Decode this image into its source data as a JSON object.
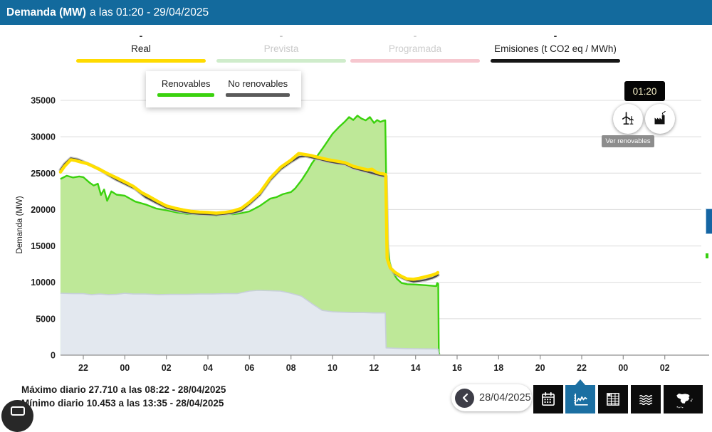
{
  "header": {
    "title_bold": "Demanda (MW)",
    "title_rest": "a las 01:20 - 29/04/2025"
  },
  "legend": {
    "items": [
      {
        "label": "Real",
        "value_dash": "-",
        "bar_color": "#ffdb00",
        "label_color": "#1d1d1d",
        "dash_color": "#2a2a2a",
        "active": true
      },
      {
        "label": "Prevista",
        "value_dash": "-",
        "bar_color": "#cfeccb",
        "label_color": "#c9c9c9",
        "dash_color": "#c4c4c4",
        "active": false
      },
      {
        "label": "Programada",
        "value_dash": "-",
        "bar_color": "#f6c7cf",
        "label_color": "#cdcdcd",
        "dash_color": "#cfcfcf",
        "active": false
      },
      {
        "label": "Emisiones (t CO2 eq / MWh)",
        "value_dash": "-",
        "bar_color": "#161616",
        "label_color": "#1d1d1d",
        "dash_color": "#2a2a2a",
        "active": true
      }
    ]
  },
  "renewables_toggle": {
    "items": [
      {
        "label": "Renovables",
        "bar_color": "#3bd20e"
      },
      {
        "label": "No renovables",
        "bar_color": "#5a5a5a"
      }
    ]
  },
  "time_tooltip": "01:20",
  "ver_renovables_tooltip": "Ver renovables",
  "footer": {
    "max_line": "Máximo diario 27.710 a las 08:22 - 28/04/2025",
    "min_line": "Mínimo diario 10.453 a las 13:35 - 28/04/2025"
  },
  "date_nav": {
    "date": "28/04/2025"
  },
  "chart_data": {
    "type": "line+area",
    "title": "Demanda (MW) a las 01:20 - 29/04/2025",
    "ylabel": "Demanda (MW)",
    "ylim": [
      0,
      35000
    ],
    "grid": "horizontal",
    "y_ticks": [
      0,
      5000,
      10000,
      15000,
      20000,
      25000,
      30000,
      35000
    ],
    "x_ticks": [
      {
        "t": 22,
        "label": "22"
      },
      {
        "t": 24,
        "label": "00"
      },
      {
        "t": 26,
        "label": "02"
      },
      {
        "t": 28,
        "label": "04"
      },
      {
        "t": 30,
        "label": "06"
      },
      {
        "t": 32,
        "label": "08"
      },
      {
        "t": 34,
        "label": "10"
      },
      {
        "t": 36,
        "label": "12"
      },
      {
        "t": 38,
        "label": "14"
      },
      {
        "t": 40,
        "label": "16"
      },
      {
        "t": 42,
        "label": "18"
      },
      {
        "t": 44,
        "label": "20"
      },
      {
        "t": 46,
        "label": "22"
      },
      {
        "t": 48,
        "label": "00"
      },
      {
        "t": 50,
        "label": "02"
      }
    ],
    "x_note": "t = decimal hours from 00:00 of 27/04; 36 = 12:00 on 28/04; blackout drop at 12:33",
    "series": [
      {
        "id": "renovables",
        "name": "Renovables",
        "kind": "area",
        "fill": "#bee898",
        "stroke": "#3bd20e",
        "stroke_width": 2.4,
        "points": [
          [
            20.9,
            24200
          ],
          [
            21.2,
            24650
          ],
          [
            21.5,
            24400
          ],
          [
            21.8,
            24550
          ],
          [
            22.0,
            24450
          ],
          [
            22.3,
            23700
          ],
          [
            22.5,
            23300
          ],
          [
            22.7,
            23550
          ],
          [
            22.85,
            22000
          ],
          [
            23.0,
            22750
          ],
          [
            23.15,
            21200
          ],
          [
            23.35,
            22500
          ],
          [
            23.6,
            22050
          ],
          [
            24.0,
            21900
          ],
          [
            24.5,
            21100
          ],
          [
            25.0,
            20700
          ],
          [
            25.5,
            20150
          ],
          [
            26.0,
            19900
          ],
          [
            26.5,
            19600
          ],
          [
            27.0,
            19400
          ],
          [
            27.5,
            19350
          ],
          [
            28.0,
            19400
          ],
          [
            28.4,
            19150
          ],
          [
            28.8,
            19500
          ],
          [
            29.2,
            19350
          ],
          [
            29.6,
            19500
          ],
          [
            30.0,
            19750
          ],
          [
            30.5,
            20500
          ],
          [
            31.0,
            21500
          ],
          [
            31.3,
            21700
          ],
          [
            31.6,
            22100
          ],
          [
            32.0,
            22400
          ],
          [
            32.2,
            22900
          ],
          [
            32.5,
            24000
          ],
          [
            32.8,
            25300
          ],
          [
            33.0,
            26300
          ],
          [
            33.3,
            27500
          ],
          [
            33.6,
            28700
          ],
          [
            34.0,
            30400
          ],
          [
            34.3,
            31300
          ],
          [
            34.6,
            32100
          ],
          [
            34.8,
            32700
          ],
          [
            35.0,
            32300
          ],
          [
            35.2,
            32900
          ],
          [
            35.4,
            32500
          ],
          [
            35.6,
            32250
          ],
          [
            35.8,
            32700
          ],
          [
            36.0,
            31900
          ],
          [
            36.15,
            32300
          ],
          [
            36.3,
            32050
          ],
          [
            36.45,
            32200
          ],
          [
            36.54,
            32250
          ],
          [
            36.58,
            24800
          ],
          [
            36.65,
            16000
          ],
          [
            36.75,
            12800
          ],
          [
            36.9,
            11400
          ],
          [
            37.1,
            10500
          ],
          [
            37.33,
            9900
          ],
          [
            37.6,
            9750
          ],
          [
            38.0,
            9700
          ],
          [
            38.5,
            9600
          ],
          [
            38.9,
            9500
          ],
          [
            39.0,
            9480
          ],
          [
            39.04,
            9900
          ],
          [
            39.09,
            9800
          ],
          [
            39.12,
            400
          ],
          [
            39.15,
            100
          ]
        ]
      },
      {
        "id": "no-renovables",
        "name": "No renovables",
        "kind": "area",
        "fill": "#e3e8ef",
        "stroke": "#c7cfda",
        "stroke_width": 1.6,
        "points": [
          [
            20.9,
            8500
          ],
          [
            21.5,
            8450
          ],
          [
            22.0,
            8450
          ],
          [
            22.4,
            8300
          ],
          [
            22.8,
            8400
          ],
          [
            23.2,
            8300
          ],
          [
            23.6,
            8350
          ],
          [
            24.0,
            8500
          ],
          [
            24.4,
            8400
          ],
          [
            25.0,
            8400
          ],
          [
            25.6,
            8300
          ],
          [
            26.2,
            8350
          ],
          [
            27.0,
            8350
          ],
          [
            27.6,
            8400
          ],
          [
            28.2,
            8400
          ],
          [
            28.8,
            8450
          ],
          [
            29.4,
            8450
          ],
          [
            30.0,
            8800
          ],
          [
            30.4,
            8900
          ],
          [
            31.0,
            8850
          ],
          [
            31.5,
            8800
          ],
          [
            32.0,
            8500
          ],
          [
            32.5,
            8100
          ],
          [
            33.0,
            7100
          ],
          [
            33.5,
            6150
          ],
          [
            34.0,
            5950
          ],
          [
            34.5,
            5900
          ],
          [
            35.0,
            5850
          ],
          [
            35.5,
            5850
          ],
          [
            36.0,
            5800
          ],
          [
            36.3,
            5800
          ],
          [
            36.54,
            5800
          ],
          [
            36.58,
            1000
          ],
          [
            37.0,
            950
          ],
          [
            37.5,
            900
          ],
          [
            38.0,
            880
          ],
          [
            38.5,
            860
          ],
          [
            39.0,
            850
          ],
          [
            39.08,
            830
          ],
          [
            39.12,
            200
          ],
          [
            39.15,
            50
          ]
        ]
      },
      {
        "id": "emisiones",
        "name": "Emisiones (t CO2 eq / MWh)",
        "kind": "line",
        "stroke": "#474747",
        "halo": "#bfbfbf",
        "stroke_width": 2.2,
        "points": [
          [
            20.9,
            25450
          ],
          [
            21.1,
            26250
          ],
          [
            21.4,
            27050
          ],
          [
            21.7,
            26900
          ],
          [
            22.0,
            26550
          ],
          [
            22.4,
            26050
          ],
          [
            22.8,
            25500
          ],
          [
            23.2,
            24750
          ],
          [
            23.6,
            24100
          ],
          [
            24.0,
            23550
          ],
          [
            24.5,
            22850
          ],
          [
            25.0,
            21700
          ],
          [
            25.5,
            20950
          ],
          [
            26.0,
            20250
          ],
          [
            26.4,
            19950
          ],
          [
            26.8,
            19700
          ],
          [
            27.2,
            19500
          ],
          [
            27.6,
            19400
          ],
          [
            28.0,
            19350
          ],
          [
            28.4,
            19300
          ],
          [
            28.8,
            19400
          ],
          [
            29.2,
            19550
          ],
          [
            29.6,
            19850
          ],
          [
            30.0,
            20750
          ],
          [
            30.5,
            22050
          ],
          [
            31.0,
            24050
          ],
          [
            31.5,
            25550
          ],
          [
            32.0,
            26550
          ],
          [
            32.4,
            27250
          ],
          [
            32.7,
            27350
          ],
          [
            33.0,
            27150
          ],
          [
            33.4,
            26900
          ],
          [
            33.8,
            26600
          ],
          [
            34.2,
            26400
          ],
          [
            34.6,
            26250
          ],
          [
            35.0,
            25700
          ],
          [
            35.4,
            25400
          ],
          [
            35.8,
            25100
          ],
          [
            36.1,
            24850
          ],
          [
            36.4,
            24650
          ],
          [
            36.58,
            24550
          ],
          [
            36.66,
            13000
          ],
          [
            36.8,
            11900
          ],
          [
            37.0,
            11200
          ],
          [
            37.3,
            10700
          ],
          [
            37.6,
            10300
          ],
          [
            37.9,
            10100
          ],
          [
            38.2,
            10200
          ],
          [
            38.5,
            10350
          ],
          [
            38.8,
            10600
          ],
          [
            39.0,
            10850
          ],
          [
            39.08,
            11000
          ]
        ]
      },
      {
        "id": "real",
        "name": "Real",
        "kind": "line",
        "stroke": "#ffdf00",
        "stroke_width": 4.4,
        "points": [
          [
            20.9,
            25150
          ],
          [
            21.1,
            25950
          ],
          [
            21.4,
            26850
          ],
          [
            21.6,
            26750
          ],
          [
            21.9,
            26500
          ],
          [
            22.2,
            26300
          ],
          [
            22.5,
            25900
          ],
          [
            22.8,
            25500
          ],
          [
            23.2,
            24900
          ],
          [
            23.6,
            24350
          ],
          [
            24.0,
            23800
          ],
          [
            24.4,
            23200
          ],
          [
            24.8,
            22350
          ],
          [
            25.2,
            21750
          ],
          [
            25.6,
            21100
          ],
          [
            26.0,
            20500
          ],
          [
            26.4,
            20200
          ],
          [
            26.8,
            19950
          ],
          [
            27.2,
            19750
          ],
          [
            27.6,
            19650
          ],
          [
            28.0,
            19600
          ],
          [
            28.4,
            19500
          ],
          [
            28.8,
            19600
          ],
          [
            29.2,
            19800
          ],
          [
            29.6,
            20150
          ],
          [
            30.0,
            21000
          ],
          [
            30.5,
            22300
          ],
          [
            31.0,
            24300
          ],
          [
            31.5,
            25800
          ],
          [
            32.0,
            26800
          ],
          [
            32.37,
            27700
          ],
          [
            32.7,
            27550
          ],
          [
            33.0,
            27400
          ],
          [
            33.4,
            27100
          ],
          [
            33.8,
            26850
          ],
          [
            34.2,
            26650
          ],
          [
            34.6,
            26450
          ],
          [
            35.0,
            25950
          ],
          [
            35.4,
            25650
          ],
          [
            35.7,
            25450
          ],
          [
            35.9,
            25550
          ],
          [
            36.1,
            25150
          ],
          [
            36.3,
            24950
          ],
          [
            36.45,
            24900
          ],
          [
            36.56,
            24800
          ],
          [
            36.63,
            13300
          ],
          [
            36.78,
            12000
          ],
          [
            37.0,
            11400
          ],
          [
            37.3,
            10850
          ],
          [
            37.58,
            10480
          ],
          [
            37.9,
            10420
          ],
          [
            38.2,
            10580
          ],
          [
            38.5,
            10780
          ],
          [
            38.8,
            11000
          ],
          [
            39.0,
            11200
          ],
          [
            39.07,
            11350
          ]
        ]
      }
    ]
  }
}
